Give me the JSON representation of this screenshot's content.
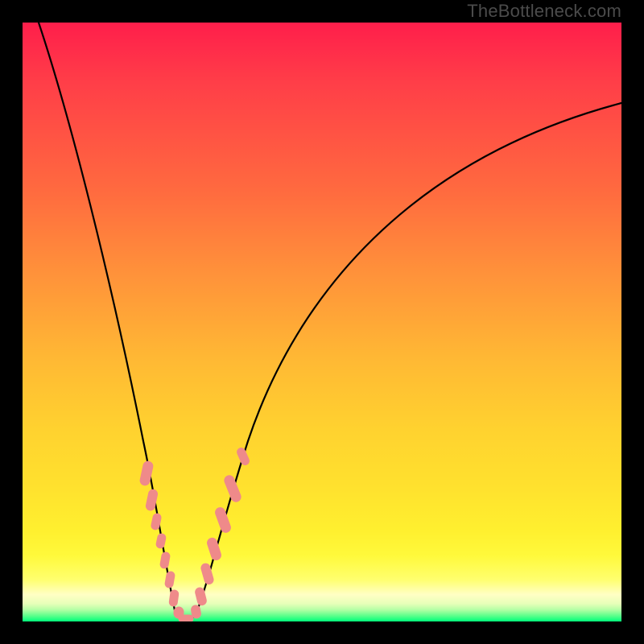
{
  "watermark": "TheBottleneck.com",
  "colors": {
    "frame": "#000000",
    "gradient_top": "#ff1e4b",
    "gradient_mid": "#ffd22f",
    "gradient_bottom": "#00ff7a",
    "curve": "#000000",
    "markers": "#ef8a8a"
  },
  "chart_data": {
    "type": "line",
    "title": "",
    "xlabel": "",
    "ylabel": "",
    "xlim": [
      0,
      100
    ],
    "ylim": [
      0,
      100
    ],
    "grid": false,
    "legend": false,
    "series": [
      {
        "name": "bottleneck-curve",
        "x": [
          0,
          5,
          10,
          15,
          20,
          22,
          24,
          25,
          26,
          28,
          30,
          35,
          40,
          50,
          60,
          70,
          80,
          90,
          100
        ],
        "y": [
          100,
          78,
          56,
          35,
          16,
          8,
          3,
          1,
          0.5,
          1,
          3,
          10,
          20,
          40,
          55,
          67,
          76,
          82,
          86
        ]
      }
    ],
    "markers": {
      "name": "highlighted-points",
      "x": [
        19,
        20,
        21,
        22,
        23,
        24,
        25,
        26,
        27,
        28,
        29,
        30,
        31,
        32
      ],
      "y": [
        23,
        18,
        14,
        10,
        6,
        3,
        1,
        0.5,
        1,
        2.5,
        5,
        9,
        13,
        18
      ]
    }
  }
}
